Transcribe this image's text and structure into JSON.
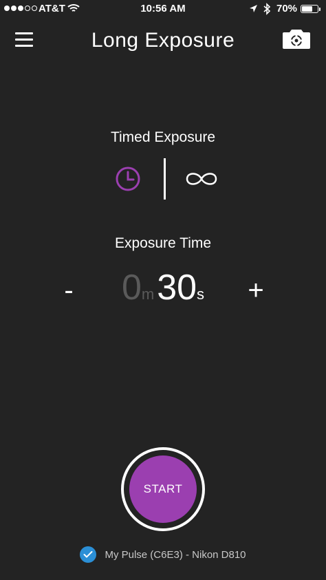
{
  "status_bar": {
    "carrier": "AT&T",
    "time": "10:56 AM",
    "battery": "70%",
    "battery_level": 0.7,
    "signal_bars_filled": 3,
    "signal_bars_total": 5
  },
  "header": {
    "title": "Long Exposure",
    "menu_icon": "hamburger-menu-icon",
    "camera_icon": "camera-settings-icon"
  },
  "timed_exposure": {
    "label": "Timed Exposure",
    "modes": [
      {
        "icon": "clock-icon",
        "active": true
      },
      {
        "icon": "infinity-icon",
        "active": false
      }
    ]
  },
  "exposure_time": {
    "label": "Exposure Time",
    "minus_label": "-",
    "plus_label": "+",
    "minutes": "0",
    "minutes_unit": "m",
    "seconds": "30",
    "seconds_unit": "s"
  },
  "start_button": {
    "label": "START"
  },
  "device": {
    "label": "My Pulse (C6E3) - Nikon D810",
    "connected": true
  },
  "colors": {
    "background": "#232323",
    "accent": "#9b3fb0",
    "check": "#2b8fd6",
    "dim_text": "#5a5a5a"
  }
}
